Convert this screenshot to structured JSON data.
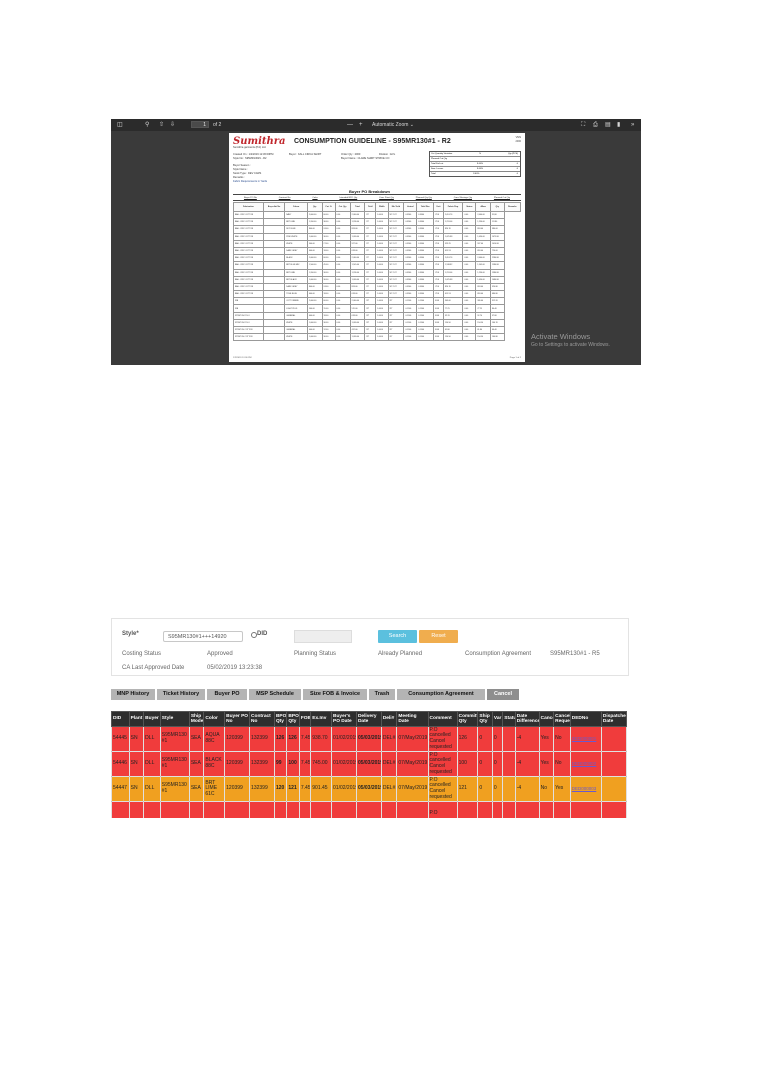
{
  "colors": {
    "viewer_bg": "#3a3a3a",
    "cancel_row": "#f03c3c",
    "active_row": "#f0a020",
    "search_button": "#5bc0de",
    "reset_button": "#f0ad4e",
    "table_header": "#2e2e2e"
  },
  "pdf_viewer": {
    "toolbar": {
      "sidebar_icon": "sidebar-toggle-icon",
      "search_icon": "search-icon",
      "prev_icon": "arrow-up-icon",
      "next_icon": "arrow-down-icon",
      "page_number": "1",
      "page_count": "of 2",
      "zoom_out": "—",
      "zoom_in": "+",
      "zoom_label": "Automatic Zoom",
      "right_icons": [
        "fullscreen-icon",
        "print-icon",
        "save-icon",
        "bookmark-icon",
        "more-icon"
      ]
    },
    "document": {
      "logo_text": "Sumithra",
      "logo_sub": "Sumithra garments (Pvt) Ltd.",
      "title": "CONSUMPTION GUIDELINE - S95MR130#1 - R2",
      "corner_lines": [
        "VMS",
        "2000"
      ],
      "header_fields": [
        [
          "Created On :",
          "1/2/2019 12:36:00PM"
        ],
        [
          "Style No :",
          "S95MR130#1 - R2"
        ],
        [
          "Buyer :",
          "KALL CIRCA SHIRT"
        ],
        [
          "Order Qty :",
          "2000"
        ],
        [
          "Division :",
          "EVL"
        ],
        [
          "Buyer Name :",
          "CLARE SHIRT STRIKE CO"
        ],
        [
          "Buyer Season :",
          ""
        ],
        [
          "Style Name :",
          ""
        ],
        [
          "Stock Type :",
          "DEV CARS"
        ],
        [
          "Remarks :",
          ""
        ],
        [
          "Fabric Requirements in Yards",
          ""
        ]
      ],
      "box_rows": [
        [
          "Cut Quantity Variation",
          "%",
          "Qty (PCS)"
        ],
        [
          "Planned Cut Qty",
          "",
          ""
        ],
        [
          "Total Fail cut",
          "3.00%",
          "0"
        ],
        [
          "Sew. Losses",
          "3.00%",
          "0"
        ],
        [
          "Total",
          "3.00%",
          "0"
        ]
      ],
      "bpo_title": "Buyer PO Breakdown",
      "bpo_strip": [
        "Buyer PO No",
        "Contract No",
        "Color",
        "Intended BPO Qty",
        "Cons Point Qty",
        "Planned Qty Qty",
        "Cons Wastage Qty",
        "Planned Cut Qty"
      ],
      "table_headers": [
        "Fabrication",
        "Buyer Art No",
        "Colour",
        "Qty",
        "Cut. %",
        "Cut. Qty",
        "Total",
        "Yield",
        "Width",
        "Mtr Yield",
        "Actual",
        "Yield Rcv",
        "Unit",
        "Fabric Req.",
        "Status",
        "Allow",
        "Qty",
        "Remarks"
      ],
      "table_rows": [
        [
          "BALL CIRC COTTON",
          "",
          "NAVY",
          "2,000.00",
          "60.00",
          "0.00",
          "2,060.00",
          "29\"",
          "1.0000",
          "58\" CUT",
          "0.9960",
          "0.9960",
          "YDS",
          "2,051.76",
          "0.00",
          "2,060.00",
          "31,80"
        ],
        [
          "BALL CIRC COTTON",
          "",
          "BRT LIME",
          "1,200.00",
          "36.00",
          "0.00",
          "1,236.00",
          "29\"",
          "1.0000",
          "58\" CUT",
          "0.9960",
          "0.9960",
          "YDS",
          "1,231.06",
          "0.00",
          "1,236.00",
          "1/3 80"
        ],
        [
          "BALL CIRC COTTON",
          "",
          "SKY BLUE",
          "800.00",
          "24.00",
          "0.00",
          "824.00",
          "29\"",
          "1.0000",
          "58\" CUT",
          "0.9960",
          "0.9960",
          "YDS",
          "820.70",
          "0.00",
          "824.00",
          "980.00"
        ],
        [
          "BALL CIRC COTTON",
          "",
          "PINK WHITE",
          "1,000.00",
          "30.00",
          "0.00",
          "1,030.00",
          "29\"",
          "1.0000",
          "58\" CUT",
          "0.9960",
          "0.9960",
          "YDS",
          "1,025.88",
          "0.00",
          "1,030.00",
          "1075.80"
        ],
        [
          "BALL CIRC COTTON",
          "",
          "WHITE",
          "900.00",
          "27.00",
          "0.00",
          "927.00",
          "29\"",
          "1.0000",
          "58\" CUT",
          "0.9960",
          "0.9960",
          "YDS",
          "923.29",
          "0.00",
          "927.00",
          "1014.80"
        ],
        [
          "BALL CIRC COTTON",
          "",
          "DARK GREY",
          "600.00",
          "18.00",
          "0.00",
          "618.00",
          "29\"",
          "1.0000",
          "58\" CUT",
          "0.9960",
          "0.9960",
          "YDS",
          "615.53",
          "0.00",
          "618.00",
          "720.00"
        ],
        [
          "BALL CIRC COTTON",
          "",
          "BLACK",
          "2,000.00",
          "60.00",
          "0.00",
          "2,060.00",
          "29\"",
          "1.0000",
          "58\" CUT",
          "0.9960",
          "0.9960",
          "YDS",
          "2,051.76",
          "0.00",
          "2,060.00",
          "2280.80"
        ],
        [
          "BALL CIRC COTTON",
          "",
          "BRT BLUE MIX",
          "1,500.00",
          "45.00",
          "0.00",
          "1,545.00",
          "29\"",
          "1.0000",
          "58\" CUT",
          "0.9960",
          "0.9960",
          "YDS",
          "1,538.82",
          "0.00",
          "1,545.00",
          "1580.80"
        ],
        [
          "BALL CIRC COTTON",
          "",
          "BRT LIME",
          "1,200.00",
          "36.00",
          "0.00",
          "1,236.00",
          "29\"",
          "1.0000",
          "58\" CUT",
          "0.9960",
          "0.9960",
          "YDS",
          "1,231.06",
          "0.00",
          "1,236.00",
          "1380.80"
        ],
        [
          "BALL CIRC COTTON",
          "",
          "BRT BLACK",
          "1,000.00",
          "30.00",
          "0.00",
          "1,030.00",
          "29\"",
          "1.0000",
          "58\" CUT",
          "0.9960",
          "0.9960",
          "YDS",
          "1,025.88",
          "0.00",
          "1,030.00",
          "1080.80"
        ],
        [
          "BALL CIRC COTTON",
          "",
          "DARK GREY",
          "800.00",
          "24.00",
          "0.00",
          "824.00",
          "29\"",
          "1.0000",
          "58\" CUT",
          "0.9960",
          "0.9960",
          "YDS",
          "820.70",
          "0.00",
          "824.00",
          "920.80"
        ],
        [
          "BALL CIRC COTTON",
          "",
          "TRUE BLUE",
          "600.00",
          "18.00",
          "0.00",
          "618.00",
          "29\"",
          "1.0000",
          "58\" CUT",
          "0.9960",
          "0.9960",
          "YDS",
          "615.53",
          "0.00",
          "618.00",
          "680.80"
        ],
        [
          "RIB",
          "",
          "COTTONBIND",
          "2,000.00",
          "60.00",
          "0.00",
          "2,060.00",
          "28\"",
          "1.0000",
          "28\"",
          "0.1500",
          "0.1500",
          "KGS",
          "309.00",
          "0.00",
          "309.00",
          "312.20"
        ],
        [
          "RIB",
          "",
          "LIGHT PLUS",
          "500.00",
          "15.00",
          "0.00",
          "515.00",
          "28\"",
          "1.0000",
          "28\"",
          "0.1500",
          "0.1500",
          "KGS",
          "77.25",
          "0.00",
          "77.25",
          "80.40"
        ],
        [
          "STRETCH POLO",
          "",
          "GENERAL",
          "600.00",
          "18.00",
          "0.00",
          "618.00",
          "28\"",
          "1.0000",
          "28\"",
          "0.1500",
          "0.1500",
          "KGS",
          "92.70",
          "0.00",
          "92.70",
          "97.80"
        ],
        [
          "STRETCH POLO",
          "",
          "WHITE",
          "1,000.00",
          "30.00",
          "0.00",
          "1,030.00",
          "28\"",
          "1.0000",
          "28\"",
          "0.1500",
          "0.1500",
          "KGS",
          "154.50",
          "0.00",
          "154.50",
          "160.70"
        ],
        [
          "STRETCH COTTON",
          "",
          "GENERAL",
          "400.00",
          "12.00",
          "0.00",
          "412.00",
          "28\"",
          "1.0000",
          "28\"",
          "0.1500",
          "0.1500",
          "KGS",
          "61.80",
          "0.00",
          "61.80",
          "66.40"
        ],
        [
          "STRETCH COTTON",
          "",
          "WHITE",
          "1,000.00",
          "30.00",
          "0.00",
          "1,030.00",
          "28\"",
          "1.0000",
          "28\"",
          "0.1500",
          "0.1500",
          "KGS",
          "154.50",
          "0.00",
          "154.50",
          "160.80"
        ]
      ],
      "footer_left": "1/2/2019 12:36 PM",
      "footer_right": "Page 1 of 2"
    },
    "activate_title": "Activate Windows",
    "activate_sub": "Go to Settings to activate Windows."
  },
  "order_screen": {
    "style_label": "Style*",
    "style_value": "S95MR130#1+++14920",
    "did_label": "DID",
    "search_button": "Search",
    "reset_button": "Reset",
    "costing_status_label": "Costing Status",
    "costing_status_value": "Approved",
    "planning_status_label": "Planning Status",
    "planning_status_value": "Already Planned",
    "consumption_agreement_label": "Consumption Agreement",
    "consumption_agreement_value": "S95MR130#1 - R5",
    "ca_last_approved_label": "CA Last Approved Date",
    "ca_last_approved_value": "05/02/2019 13:23:38",
    "tabs": [
      "MNP History",
      "Ticket History",
      "Buyer PO",
      "MSP Schedule",
      "Size FOB & Invoice",
      "Trash",
      "Consumption Agreement",
      "Cancel"
    ],
    "active_tab": "Cancel",
    "columns": [
      "DID",
      "Plant",
      "Buyer",
      "Style",
      "Ship Mode",
      "Color",
      "Buyer PO No",
      "Contract No",
      "BPO Qty",
      "BPO Qty",
      "FOB",
      "Ex.Inv",
      "Buyer's PO Date",
      "Delivery Date",
      "Deli#",
      "Meeting Date",
      "Comment",
      "Committed Qty",
      "Ship Qty",
      "Var",
      "Status",
      "Date Difference",
      "Cancel",
      "Cancel Request",
      "DEDNo",
      "Dispatched Date"
    ],
    "rows": [
      {
        "status": "cancel",
        "cells": [
          "54445",
          "SN",
          "DLL",
          "S95MR130 #1",
          "SEA",
          "AQUA 88C",
          "120399",
          "132399",
          "126",
          "126",
          "7.45",
          "938.70",
          "01/02/2019",
          "05/03/2019",
          "DEL#1",
          "07/May/2019",
          "P.O cancelled Cancel requested",
          "126",
          "0",
          "0",
          "",
          "-4",
          "Yes",
          "No",
          "DED000001",
          ""
        ]
      },
      {
        "status": "cancel",
        "cells": [
          "54446",
          "SN",
          "DLL",
          "S95MR130 #1",
          "SEA",
          "BLACK 88C",
          "120399",
          "132399",
          "99",
          "100",
          "7.45",
          "745.00",
          "01/02/2019",
          "05/03/2019",
          "DEL#1",
          "07/May/2019",
          "P.O cancelled Cancel requested",
          "100",
          "0",
          "0",
          "",
          "-4",
          "Yes",
          "No",
          "DED000002",
          ""
        ]
      },
      {
        "status": "active",
        "cells": [
          "54447",
          "SN",
          "DLL",
          "S95MR130 #1",
          "SEA",
          "BRT LIME 61C",
          "120399",
          "132399",
          "120",
          "121",
          "7.45",
          "901.45",
          "01/02/2019",
          "05/03/2019",
          "DEL#1",
          "07/May/2019",
          "P.O cancelled Cancel requested",
          "121",
          "0",
          "0",
          "",
          "-4",
          "No",
          "Yes",
          "DED000003",
          ""
        ]
      },
      {
        "status": "cancel",
        "cells": [
          "",
          "",
          "",
          "",
          "",
          "",
          "",
          "",
          "",
          "",
          "",
          "",
          "",
          "",
          "",
          "",
          "P.O",
          "",
          "",
          "",
          "",
          "",
          "",
          "",
          "",
          ""
        ]
      }
    ]
  }
}
